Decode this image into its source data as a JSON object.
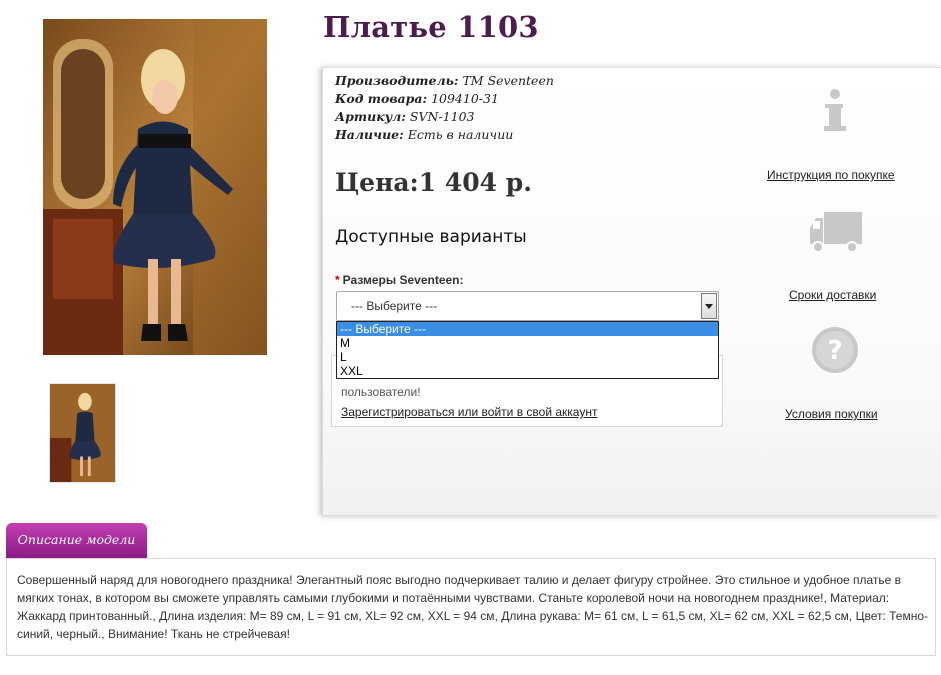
{
  "product": {
    "title": "Платье 1103",
    "meta": [
      {
        "label": "Производитель:",
        "value": "TM Seventeen"
      },
      {
        "label": "Код товара:",
        "value": "109410-31"
      },
      {
        "label": "Артикул:",
        "value": "SVN-1103"
      },
      {
        "label": "Наличие:",
        "value": "Есть в наличии"
      }
    ],
    "price": "Цена:1 404 р.",
    "variants_title": "Доступные варианты",
    "size": {
      "required_mark": "*",
      "label": "Размеры Seventeen:",
      "selected": "--- Выберите ---",
      "options": [
        "--- Выберите ---",
        "M",
        "L",
        "XXL"
      ]
    },
    "login_hint": {
      "text": "пользователи!",
      "link": "Зарегистрироваться или войти в свой аккаунт"
    }
  },
  "help": [
    {
      "icon": "info-icon",
      "label": "Инструкция по покупке"
    },
    {
      "icon": "delivery-truck-icon",
      "label": "Сроки доставки"
    },
    {
      "icon": "question-icon",
      "label": "Условия покупки"
    }
  ],
  "description": {
    "tab_label": "Описание модели",
    "text": "Совершенный наряд для новогоднего праздника! Элегантный пояс выгодно подчеркивает талию и делает фигуру стройнее. Это стильное и удобное платье в мягких тонах, в котором вы сможете управлять самыми глубокими и потаёнными чувствами. Станьте королевой ночи на новогоднем празднике!, Материал: Жаккард принтованный., Длина изделия: M= 89 см, L = 91 см, XL= 92 см, XXL = 94 см, Длина рукава: M= 61 см, L = 61,5 см, XL= 62 см, XXL = 62,5 см, Цвет: Темно-синий, черный., Внимание! Ткань не стрейчевая!"
  },
  "colors": {
    "title": "#4c1c4e",
    "tab_gradient_top": "#c23fb3",
    "tab_gradient_bottom": "#8a1a84",
    "dropdown_selected": "#3a8ee6",
    "help_icon_gray": "#c8c8c8"
  }
}
